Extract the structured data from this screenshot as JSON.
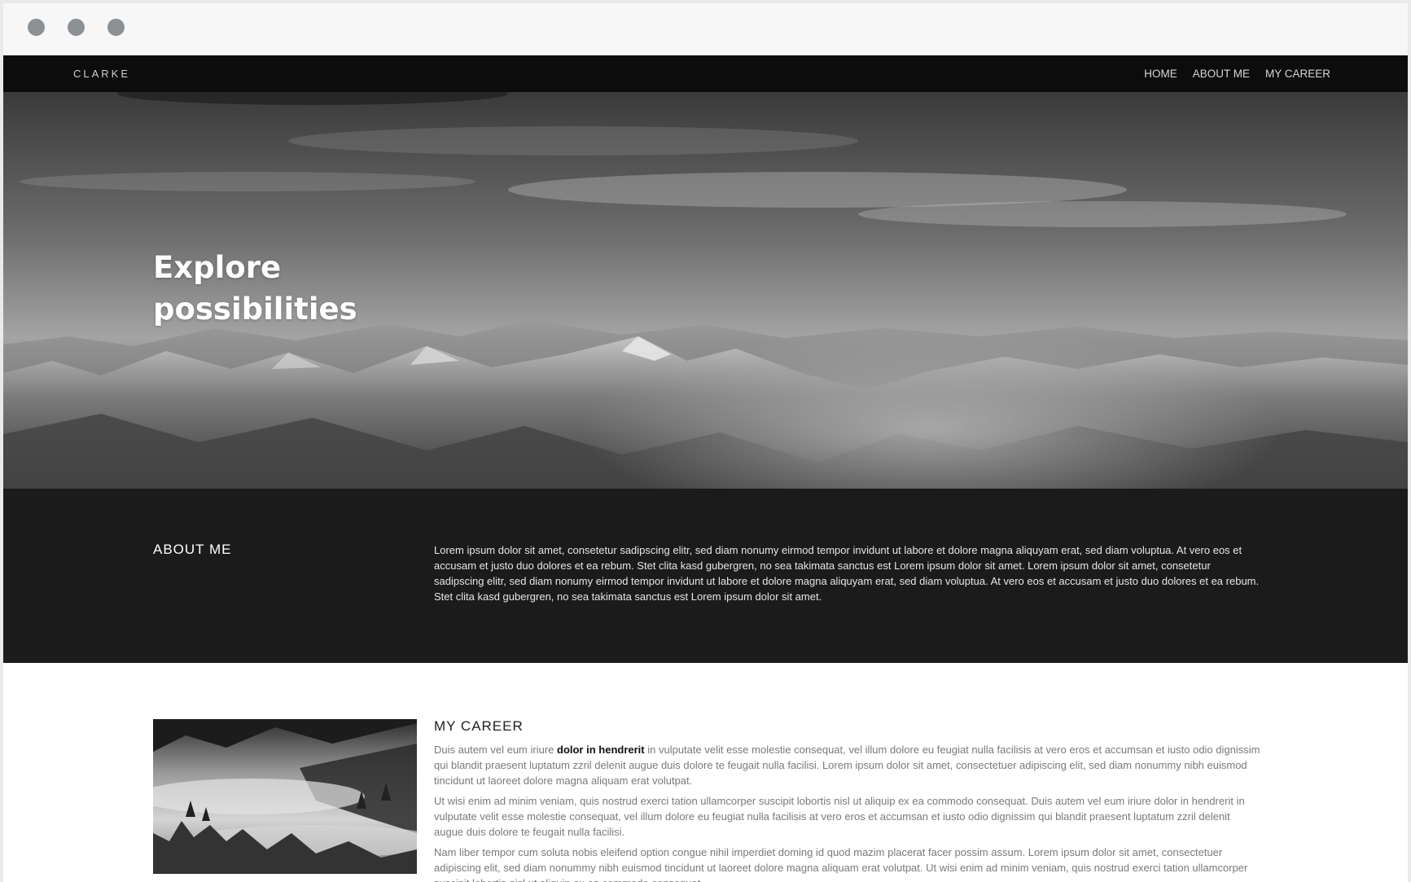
{
  "browser": {
    "controls": [
      "close",
      "minimize",
      "maximize"
    ]
  },
  "navbar": {
    "brand": "CLARKE",
    "links": [
      "HOME",
      "ABOUT ME",
      "MY CAREER"
    ]
  },
  "hero": {
    "title": "Explore possibilities",
    "image": "mountain-range-clouds-grayscale"
  },
  "about": {
    "heading": "ABOUT ME",
    "text": "Lorem ipsum dolor sit amet, consetetur sadipscing elitr, sed diam nonumy eirmod tempor invidunt ut labore et dolore magna aliquyam erat, sed diam voluptua. At vero eos et accusam et justo duo dolores et ea rebum. Stet clita kasd gubergren, no sea takimata sanctus est Lorem ipsum dolor sit amet. Lorem ipsum dolor sit amet, consetetur sadipscing elitr, sed diam nonumy eirmod tempor invidunt ut labore et dolore magna aliquyam erat, sed diam voluptua. At vero eos et accusam et justo duo dolores et ea rebum. Stet clita kasd gubergren, no sea takimata sanctus est Lorem ipsum dolor sit amet."
  },
  "career": {
    "heading": "MY CAREER",
    "image": "misty-forest-grayscale",
    "p1_before": "Duis autem vel eum iriure ",
    "p1_bold": "dolor in hendrerit",
    "p1_after": " in vulputate velit esse molestie consequat, vel illum dolore eu feugiat nulla facilisis at vero eros et accumsan et iusto odio dignissim qui blandit praesent luptatum zzril delenit augue duis dolore te feugait nulla facilisi. Lorem ipsum dolor sit amet, consectetuer adipiscing elit, sed diam nonummy nibh euismod tincidunt ut laoreet dolore magna aliquam erat volutpat.",
    "p2": "Ut wisi enim ad minim veniam, quis nostrud exerci tation ullamcorper suscipit lobortis nisl ut aliquip ex ea commodo consequat. Duis autem vel eum iriure dolor in hendrerit in vulputate velit esse molestie consequat, vel illum dolore eu feugiat nulla facilisis at vero eros et accumsan et iusto odio dignissim qui blandit praesent luptatum zzril delenit augue duis dolore te feugait nulla facilisi.",
    "p3": "Nam liber tempor cum soluta nobis eleifend option congue nihil imperdiet doming id quod mazim placerat facer possim assum. Lorem ipsum dolor sit amet, consectetuer adipiscing elit, sed diam nonummy nibh euismod tincidunt ut laoreet dolore magna aliquam erat volutpat. Ut wisi enim ad minim veniam, quis nostrud exerci tation ullamcorper suscipit lobortis nisl ut aliquip ex ea commodo consequat."
  }
}
